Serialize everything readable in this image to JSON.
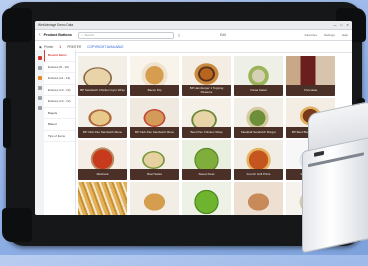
{
  "window": {
    "title": "WebVantage Demo Data",
    "controls": [
      "—",
      "□",
      "✕"
    ]
  },
  "appbar": {
    "title": "Product Buttons",
    "search_placeholder": "Search",
    "center_label": "Edit",
    "tools": [
      "Favorites",
      "Settings",
      "Help"
    ]
  },
  "toolbar": {
    "printer_label": "Printer",
    "count": "1",
    "status": "PRINTER",
    "link": "COPYRIGHT AVAILABLE"
  },
  "sidebar": {
    "icons": [
      "home-icon",
      "tag-icon",
      "list-icon",
      "clock-icon",
      "print-icon",
      "gear-icon"
    ]
  },
  "categories": [
    {
      "label": "Recent Items",
      "active": true
    },
    {
      "label": "Entrées (8 - 10)",
      "active": false
    },
    {
      "label": "Entrées (11 - 12)",
      "active": false
    },
    {
      "label": "Entrées (13 - 12)",
      "active": false
    },
    {
      "label": "Entrées (14 - 12)",
      "active": false
    },
    {
      "label": "Bagels",
      "active": false
    },
    {
      "label": "Baked",
      "active": false
    },
    {
      "label": "Tips of Items",
      "active": false
    }
  ],
  "products": [
    {
      "label": "BP Sandwich Chicken Gyro Wrap",
      "photo": "wrap"
    },
    {
      "label": "Bacon Dip",
      "photo": "soup"
    },
    {
      "label": "BP Hamburger 1 Topping Pleasure",
      "photo": "burger"
    },
    {
      "label": "Pasta Salad",
      "photo": "salad"
    },
    {
      "label": "Chocolate",
      "photo": "drink"
    },
    {
      "label": "BP Club Pan Sandwich Menu",
      "photo": "club"
    },
    {
      "label": "BP Club Pan Sandwich Menu",
      "photo": "sand"
    },
    {
      "label": "Beef Pan Chicken Wrap",
      "photo": "wrap2"
    },
    {
      "label": "Meatball Sandwich Burger",
      "photo": "pesto"
    },
    {
      "label": "BP Beef Burger Dipped Bun",
      "photo": "fish"
    },
    {
      "label": "Marinara",
      "photo": "sauce"
    },
    {
      "label": "Beef Salsa",
      "photo": "wrap3"
    },
    {
      "label": "Sweet Peas",
      "photo": "peas"
    },
    {
      "label": "French Grill Pizza",
      "photo": "pizza"
    },
    {
      "label": "Mac & Cheese",
      "photo": "mac"
    },
    {
      "label": "",
      "photo": "fries"
    },
    {
      "label": "",
      "photo": "bread"
    },
    {
      "label": "",
      "photo": "ed"
    },
    {
      "label": "",
      "photo": "ham"
    },
    {
      "label": "",
      "photo": "rice"
    }
  ],
  "colors": {
    "accent": "#d53a2f",
    "tile_label_bg": "#4a3027"
  }
}
